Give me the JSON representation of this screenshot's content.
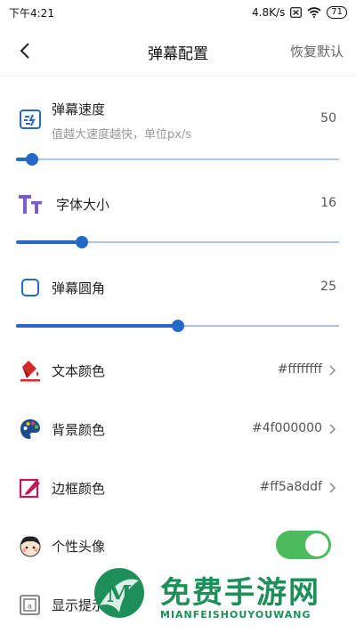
{
  "status_bar": {
    "time": "下午4:21",
    "network_speed": "4.8K/s",
    "battery": "71"
  },
  "app_bar": {
    "title": "弹幕配置",
    "reset_label": "恢复默认"
  },
  "settings": {
    "speed": {
      "label": "弹幕速度",
      "hint": "值越大速度越快，单位px/s",
      "value": "50",
      "slider_fraction": 0.05
    },
    "font_size": {
      "label": "字体大小",
      "value": "16",
      "slider_fraction": 0.205
    },
    "corner": {
      "label": "弹幕圆角",
      "value": "25",
      "slider_fraction": 0.5
    },
    "text_color": {
      "label": "文本颜色",
      "value": "#ffffffff"
    },
    "bg_color": {
      "label": "背景颜色",
      "value": "#4f000000"
    },
    "border_color": {
      "label": "边框颜色",
      "value": "#ff5a8ddf"
    },
    "avatar": {
      "label": "个性头像",
      "enabled": true
    },
    "hint": {
      "label": "显示提示"
    }
  },
  "colors": {
    "accent": "#2469c8",
    "toggle_on": "#4cbb5e",
    "watermark": "#1f8f5a"
  },
  "watermark": {
    "cn": "免费手游网",
    "en": "MIANFEISHOUYOUWANG"
  }
}
